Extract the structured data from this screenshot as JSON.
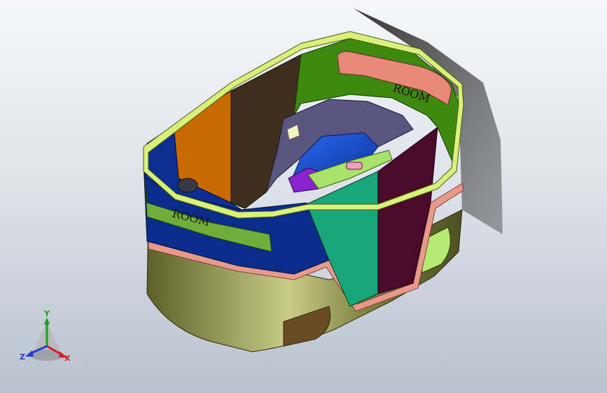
{
  "model": {
    "engraving_front": "ROOM",
    "engraving_back": "ROOM"
  },
  "triad": {
    "x_label": "X",
    "y_label": "Y",
    "z_label": "Z",
    "x_color": "#d42020",
    "y_color": "#1aa01a",
    "z_color": "#1f3fd0"
  },
  "colors": {
    "lip": "#d9f07a",
    "interior_green": "#3e8a10",
    "interior_brown": "#3e2f1d",
    "orange_panel": "#c96a00",
    "blue_band": "#0a2c8a",
    "teal_panel": "#19a77a",
    "maroon_panel": "#4a0a2a",
    "olive_base": "#6f7236",
    "salmon_strip": "#e89a8a",
    "seat_purple": "#5a5680",
    "seat_blue": "#1e5ad8",
    "light_green_pad": "#a8e26a"
  }
}
